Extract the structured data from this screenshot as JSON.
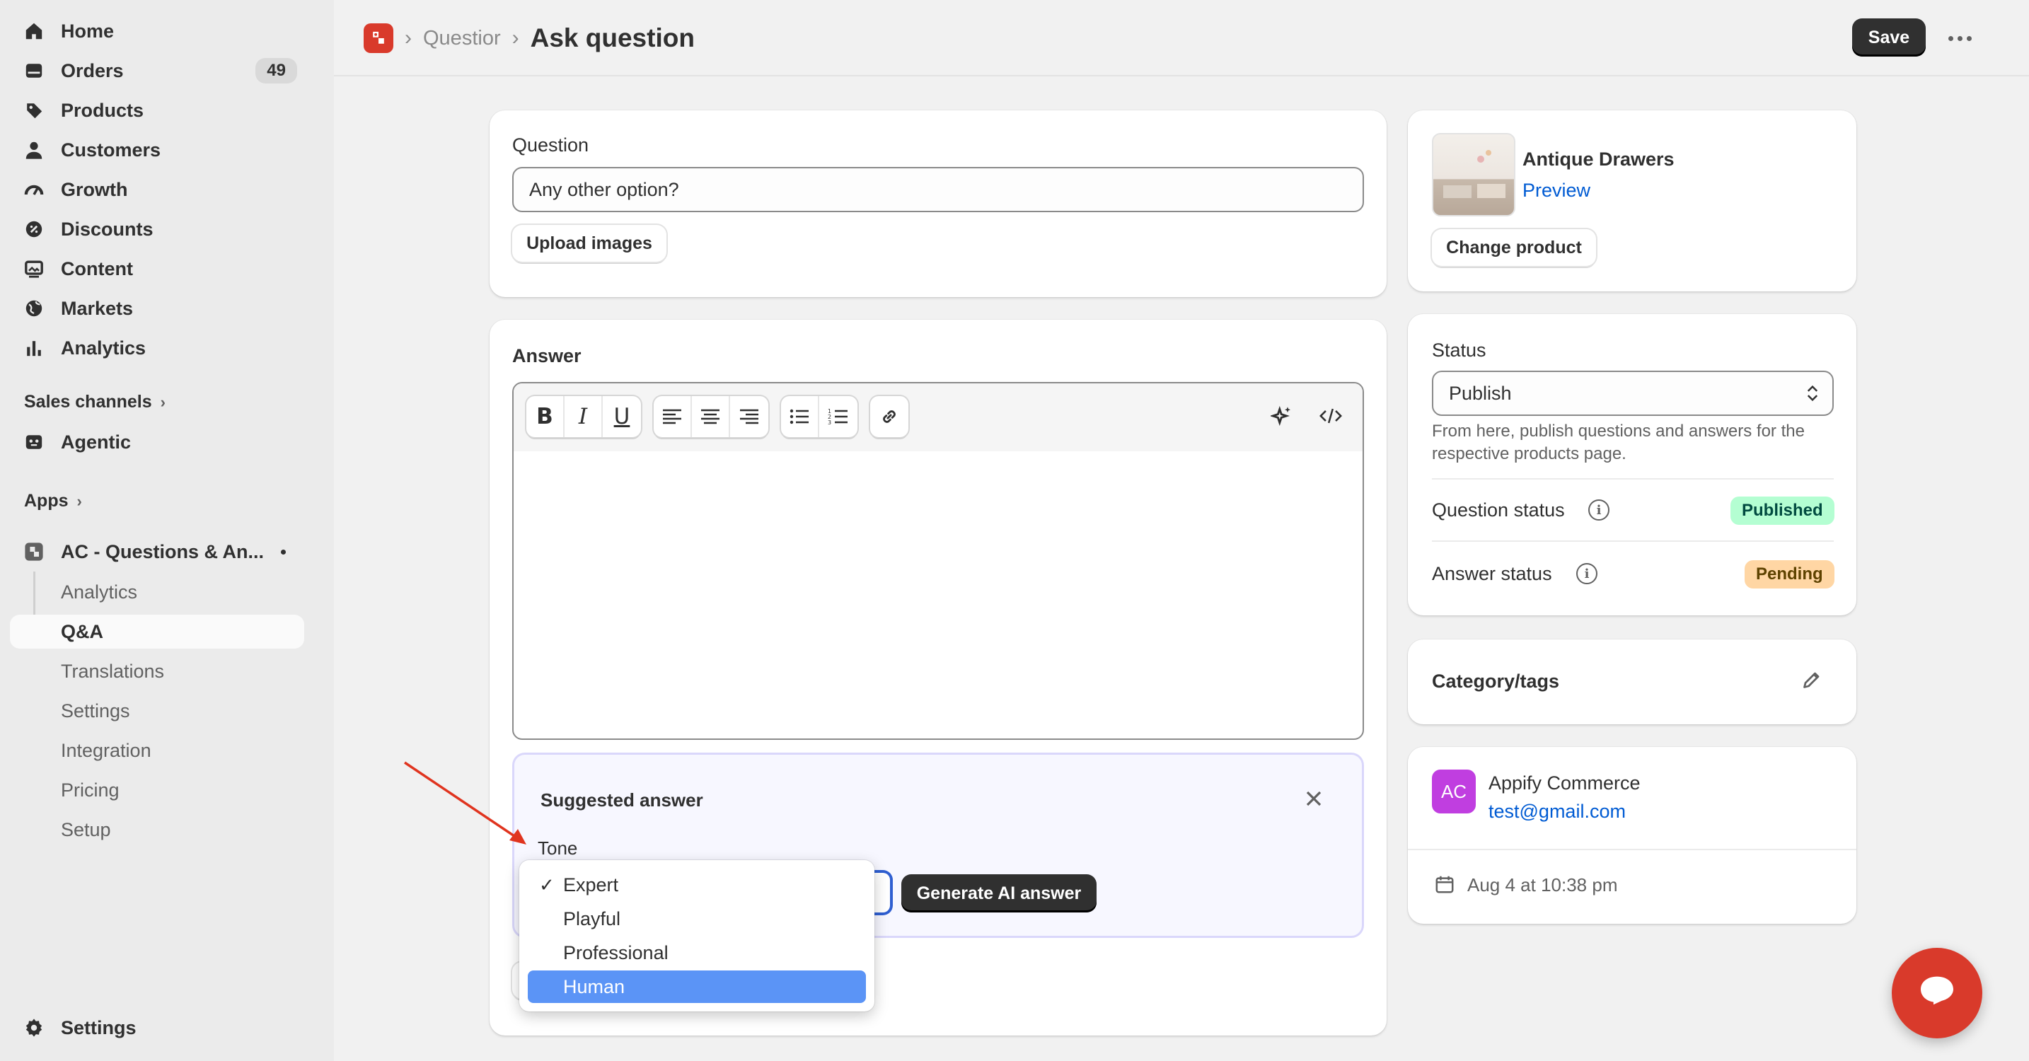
{
  "sidebar": {
    "items": [
      {
        "label": "Home",
        "icon": "home-icon"
      },
      {
        "label": "Orders",
        "icon": "orders-icon",
        "badge": "49"
      },
      {
        "label": "Products",
        "icon": "tag-icon"
      },
      {
        "label": "Customers",
        "icon": "person-icon"
      },
      {
        "label": "Growth",
        "icon": "gauge-icon"
      },
      {
        "label": "Discounts",
        "icon": "discount-icon"
      },
      {
        "label": "Content",
        "icon": "content-icon"
      },
      {
        "label": "Markets",
        "icon": "globe-icon"
      },
      {
        "label": "Analytics",
        "icon": "bar-chart-icon"
      }
    ],
    "sales_channels_label": "Sales channels",
    "agentic_label": "Agentic",
    "apps_label": "Apps",
    "app_name": "AC - Questions & An...",
    "app_subitems": [
      "Analytics",
      "Q&A",
      "Translations",
      "Settings",
      "Integration",
      "Pricing",
      "Setup"
    ],
    "settings_label": "Settings"
  },
  "header": {
    "breadcrumb_parent": "Questior",
    "title": "Ask question",
    "save_label": "Save"
  },
  "question_card": {
    "label": "Question",
    "value": "Any other option?",
    "upload_label": "Upload images"
  },
  "answer_card": {
    "label": "Answer",
    "suggest_title": "Suggested answer",
    "tone_label": "Tone",
    "tone_options": [
      "Expert",
      "Playful",
      "Professional",
      "Human"
    ],
    "tone_selected": "Expert",
    "tone_highlighted": "Human",
    "generate_label": "Generate AI answer"
  },
  "product_card": {
    "name": "Antique Drawers",
    "preview_label": "Preview",
    "change_label": "Change product"
  },
  "status_card": {
    "label": "Status",
    "value": "Publish",
    "help": "From here, publish questions and answers for the respective products page.",
    "question_status_label": "Question status",
    "question_status_value": "Published",
    "answer_status_label": "Answer status",
    "answer_status_value": "Pending"
  },
  "category_card": {
    "title": "Category/tags"
  },
  "customer_card": {
    "initials": "AC",
    "name": "Appify Commerce",
    "email": "test@gmail.com",
    "date": "Aug 4 at 10:38 pm"
  },
  "colors": {
    "accent": "#d93a2b",
    "link": "#005bd3",
    "published_bg": "#b4fed2",
    "pending_bg": "#ffd6a4",
    "highlight": "#5b94f6"
  }
}
